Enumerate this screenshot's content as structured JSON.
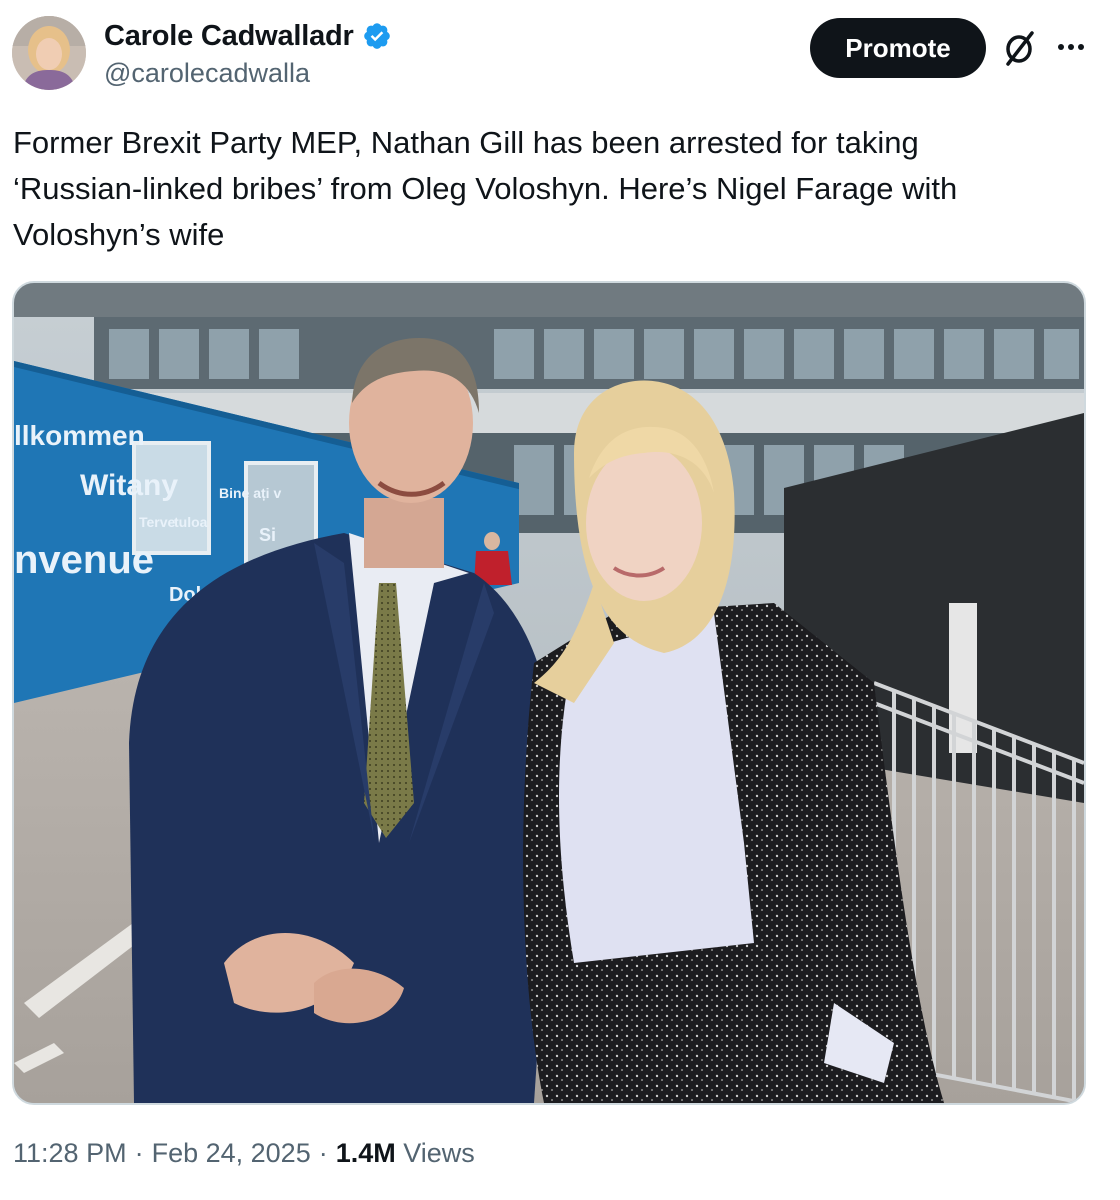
{
  "author": {
    "display_name": "Carole Cadwalladr",
    "handle": "@carolecadwalla",
    "verified": true
  },
  "header": {
    "promote_label": "Promote",
    "grok_icon": "grok-slash-icon",
    "more_icon": "more-dots-icon"
  },
  "tweet": {
    "text_lines": [
      "Former Brexit Party MEP, Nathan Gill has been arrested for taking",
      "‘Russian-linked bribes’ from Oleg Voloshyn. Here’s Nigel Farage with",
      "Voloshyn’s wife"
    ]
  },
  "photo": {
    "sign_words": [
      "llkommen",
      "Witany",
      "Terve",
      "tuloa",
      "nvenue",
      "Dobro",
      "Bine ați v",
      "Si"
    ]
  },
  "meta": {
    "time": "11:28 PM",
    "date": "Feb 24, 2025",
    "separator": "·",
    "views_count": "1.4M",
    "views_label": "Views"
  },
  "colors": {
    "text_primary": "#0f1419",
    "text_secondary": "#536471",
    "verified_blue": "#1d9bf0",
    "button_bg": "#0f1419",
    "signage_blue": "#1f76b5"
  }
}
